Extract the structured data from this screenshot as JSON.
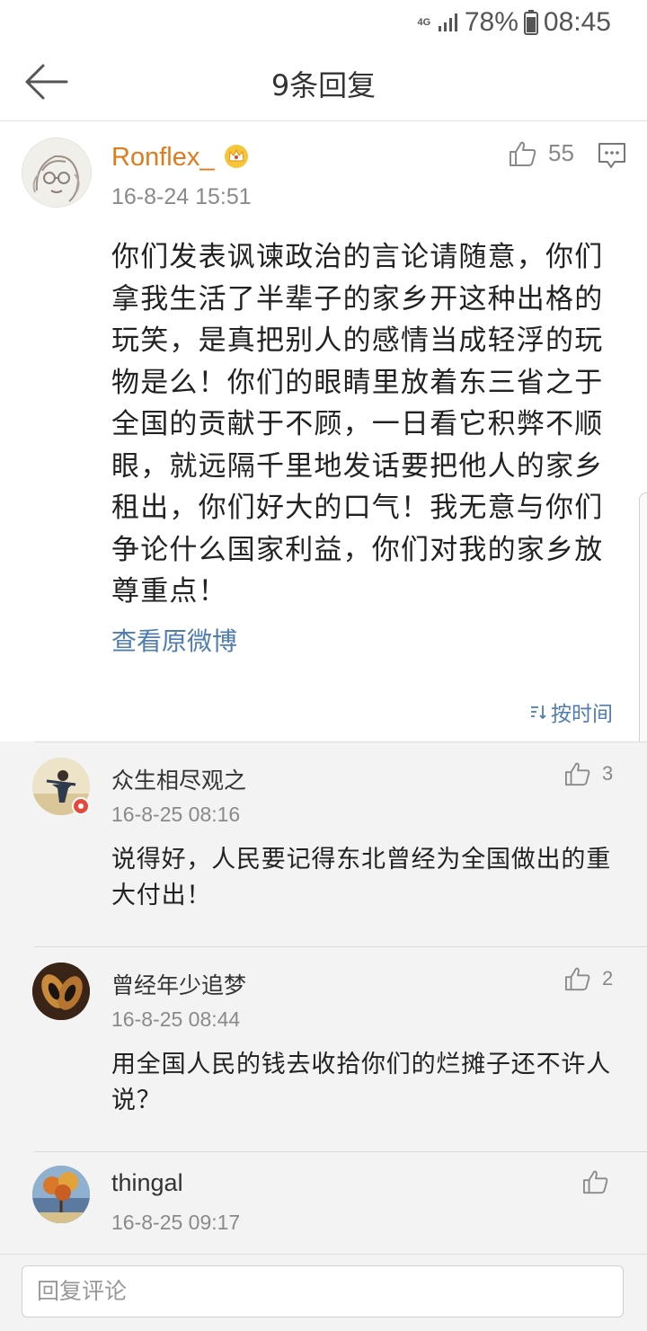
{
  "status_bar": {
    "network": "4G",
    "battery": "78%",
    "time": "08:45"
  },
  "header": {
    "title": "9条回复"
  },
  "main_comment": {
    "username": "Ronflex_",
    "timestamp": "16-8-24 15:51",
    "likes": "55",
    "text": "你们发表讽谏政治的言论请随意，你们拿我生活了半辈子的家乡开这种出格的玩笑，是真把别人的感情当成轻浮的玩物是么！你们的眼睛里放着东三省之于全国的贡献于不顾，一日看它积弊不顺眼，就远隔千里地发话要把他人的家乡租出，你们好大的口气！我无意与你们争论什么国家利益，你们对我的家乡放尊重点！",
    "view_original": "查看原微博",
    "sort_label": "按时间"
  },
  "replies": [
    {
      "username": "众生相尽观之",
      "timestamp": "16-8-25 08:16",
      "likes": "3",
      "text": "说得好，人民要记得东北曾经为全国做出的重大付出！"
    },
    {
      "username": "曾经年少追梦",
      "timestamp": "16-8-25 08:44",
      "likes": "2",
      "text": "用全国人民的钱去收拾你们的烂摊子还不许人说？"
    },
    {
      "username": "thingal",
      "timestamp": "16-8-25 09:17",
      "likes": "",
      "text": ""
    }
  ],
  "reply_input": {
    "placeholder": "回复评论"
  },
  "colors": {
    "username_main": "#e07b1c",
    "link": "#507daf",
    "reply_background": "#f3f3f3"
  }
}
